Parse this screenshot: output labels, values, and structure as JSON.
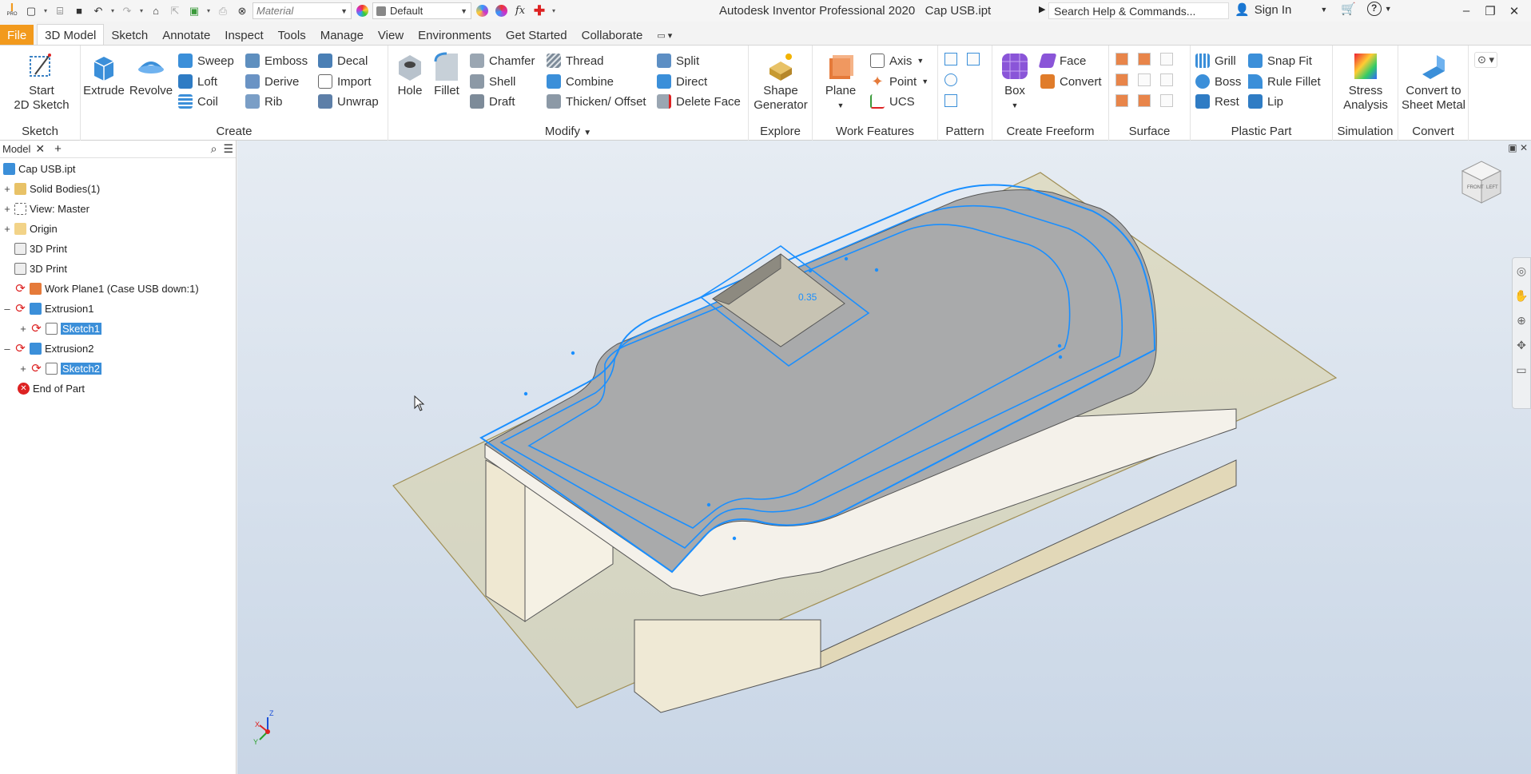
{
  "app": {
    "title": "Autodesk Inventor Professional 2020",
    "document": "Cap USB.ipt",
    "logo_text": "PRO"
  },
  "quick_access": {
    "material_placeholder": "Material",
    "appearance": "Default"
  },
  "help_search": "Search Help & Commands...",
  "sign_in": "Sign In",
  "tabs": [
    "File",
    "3D Model",
    "Sketch",
    "Annotate",
    "Inspect",
    "Tools",
    "Manage",
    "View",
    "Environments",
    "Get Started",
    "Collaborate"
  ],
  "ribbon": {
    "sketch": {
      "title": "Sketch",
      "start": "Start\n2D Sketch"
    },
    "create": {
      "title": "Create",
      "extrude": "Extrude",
      "revolve": "Revolve",
      "sweep": "Sweep",
      "loft": "Loft",
      "coil": "Coil",
      "emboss": "Emboss",
      "derive": "Derive",
      "rib": "Rib",
      "decal": "Decal",
      "import": "Import",
      "unwrap": "Unwrap"
    },
    "modify": {
      "title": "Modify",
      "hole": "Hole",
      "fillet": "Fillet",
      "chamfer": "Chamfer",
      "shell": "Shell",
      "draft": "Draft",
      "thread": "Thread",
      "combine": "Combine",
      "thicken": "Thicken/ Offset",
      "split": "Split",
      "direct": "Direct",
      "delete_face": "Delete Face"
    },
    "explore": {
      "title": "Explore",
      "shape_generator": "Shape\nGenerator"
    },
    "work_features": {
      "title": "Work Features",
      "plane": "Plane",
      "axis": "Axis",
      "point": "Point",
      "ucs": "UCS"
    },
    "pattern": {
      "title": "Pattern"
    },
    "freeform": {
      "title": "Create Freeform",
      "box": "Box",
      "face": "Face",
      "convert": "Convert"
    },
    "surface": {
      "title": "Surface"
    },
    "plastic": {
      "title": "Plastic Part",
      "grill": "Grill",
      "boss": "Boss",
      "rest": "Rest",
      "snap_fit": "Snap Fit",
      "rule_fillet": "Rule Fillet",
      "lip": "Lip"
    },
    "simulation": {
      "title": "Simulation",
      "stress": "Stress\nAnalysis"
    },
    "convert": {
      "title": "Convert",
      "sheet_metal": "Convert to\nSheet Metal"
    }
  },
  "browser": {
    "tab_label": "Model",
    "nodes": [
      {
        "label": "Cap USB.ipt"
      },
      {
        "label": "Solid Bodies(1)"
      },
      {
        "label": "View: Master"
      },
      {
        "label": "Origin"
      },
      {
        "label": "3D Print"
      },
      {
        "label": "3D Print"
      },
      {
        "label": "Work Plane1 (Case USB down:1)"
      },
      {
        "label": "Extrusion1"
      },
      {
        "label": "Sketch1"
      },
      {
        "label": "Extrusion2"
      },
      {
        "label": "Sketch2"
      },
      {
        "label": "End of Part"
      }
    ]
  },
  "viewport": {
    "dimension": "0.35",
    "axis_labels": {
      "x": "X",
      "y": "Y",
      "z": "Z"
    },
    "viewcube_labels": {
      "front": "FRONT",
      "left": "LEFT"
    }
  },
  "colors": {
    "file_tab": "#f29a1d",
    "selection": "#3b8fd9",
    "sketch_line": "#1a8fff"
  }
}
